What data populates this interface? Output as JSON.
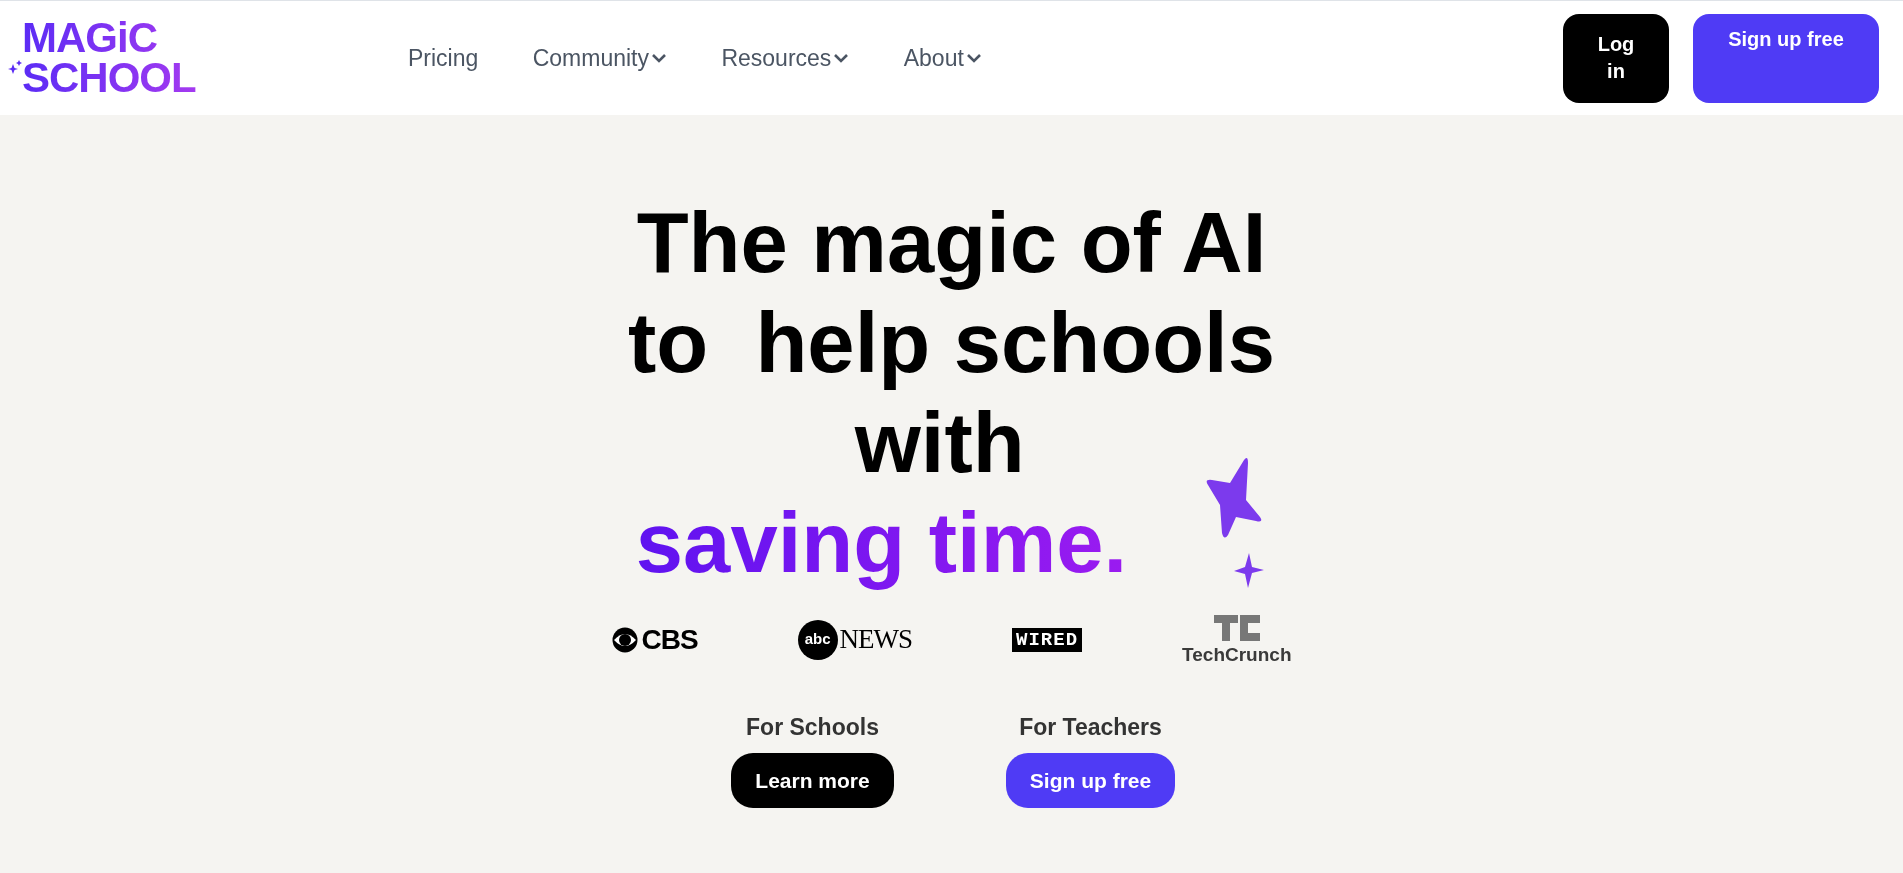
{
  "logo": {
    "lines": [
      "MAGiC",
      "SCHOOL"
    ]
  },
  "nav": [
    {
      "label": "Pricing",
      "dropdown": false
    },
    {
      "label": "Community",
      "dropdown": true
    },
    {
      "label": "Resources",
      "dropdown": true
    },
    {
      "label": "About",
      "dropdown": true
    }
  ],
  "header_buttons": [
    {
      "label": "Log in",
      "kind": "dark"
    },
    {
      "label": "Sign up free",
      "kind": "primary"
    }
  ],
  "hero": {
    "heading": "The magic of AI to  help schools with",
    "highlight": "saving time."
  },
  "press_logos": [
    {
      "kind": "cbs",
      "text": "CBS"
    },
    {
      "kind": "abc",
      "badge": "abc",
      "text": "NEWS"
    },
    {
      "kind": "wired",
      "text": "WIRED"
    },
    {
      "kind": "techcrunch",
      "text": "TechCrunch"
    }
  ],
  "cta": [
    {
      "label": "For Schools",
      "button": "Learn more",
      "kind": "dark"
    },
    {
      "label": "For Teachers",
      "button": "Sign up free",
      "kind": "primary"
    }
  ]
}
